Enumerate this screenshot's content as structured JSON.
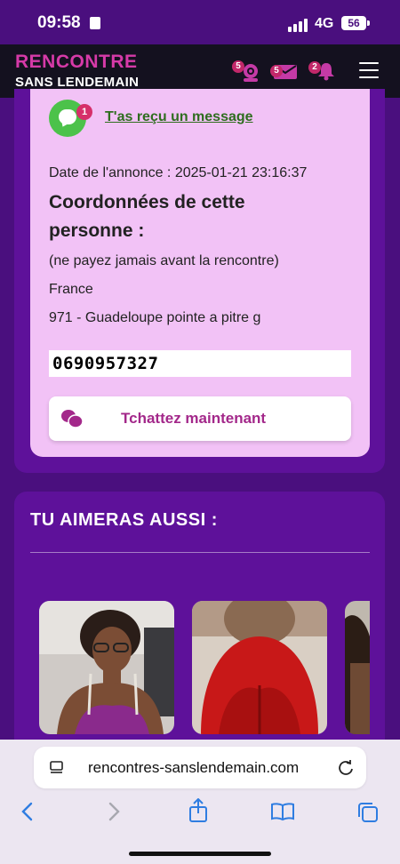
{
  "status_bar": {
    "time": "09:58",
    "network": "4G",
    "battery": "56"
  },
  "header": {
    "logo_line1": "RENCONTRE",
    "logo_line2": "SANS LENDEMAIN",
    "webcam_badge": "5",
    "mail_badge": "5",
    "notif_badge": "2"
  },
  "annonce": {
    "message_badge": "1",
    "message_link": "T'as reçu un message",
    "date": "Date de l'annonce : 2025-01-21 23:16:37",
    "coord_title": "Coordonnées de cette personne :",
    "warning": "(ne payez jamais avant la rencontre)",
    "country": "France",
    "location": "971 - Guadeloupe pointe a pitre g",
    "phone": "0690957327",
    "chat_button": "Tchattez maintenant"
  },
  "suggestions": {
    "title": "TU AIMERAS AUSSI :"
  },
  "browser": {
    "url": "rencontres-sanslendemain.com"
  },
  "colors": {
    "page_bg": "#4a0f7e",
    "panel": "#5e119a",
    "card": "#f2c2f6",
    "accent": "#d63aa8",
    "link_green": "#2f6d1f"
  }
}
